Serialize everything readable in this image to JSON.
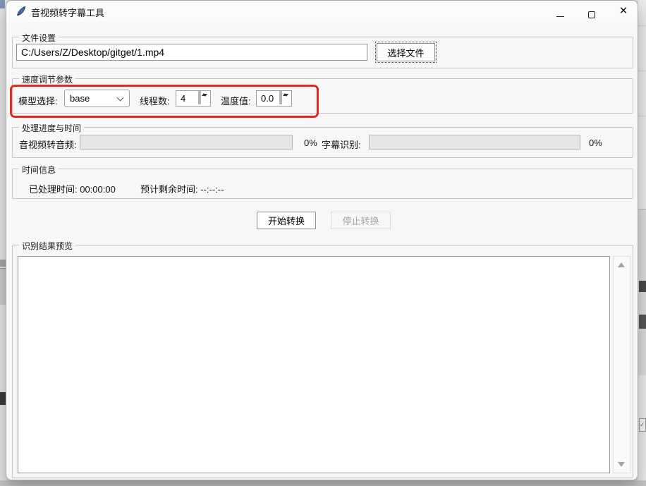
{
  "window": {
    "title": "音视频转字幕工具"
  },
  "file_settings": {
    "group_label": "文件设置",
    "file_path": "C:/Users/Z/Desktop/gitget/1.mp4",
    "select_file_button": "选择文件"
  },
  "speed_params": {
    "group_label": "速度调节参数",
    "model_label": "模型选择:",
    "model_value": "base",
    "threads_label": "线程数:",
    "threads_value": "4",
    "temperature_label": "温度值:",
    "temperature_value": "0.0",
    "annotation_color": "#e02a1e"
  },
  "progress": {
    "group_label": "处理进度与时间",
    "audio_label": "音视频转音频:",
    "audio_percent": "0%",
    "subtitle_label": "字幕识别:",
    "subtitle_percent": "0%"
  },
  "time_info": {
    "group_label": "时间信息",
    "elapsed": "已处理时间: 00:00:00",
    "remaining": "预计剩余时间: --:--:--"
  },
  "actions": {
    "start_label": "开始转换",
    "stop_label": "停止转换"
  },
  "preview": {
    "group_label": "识别结果预览",
    "content": ""
  }
}
